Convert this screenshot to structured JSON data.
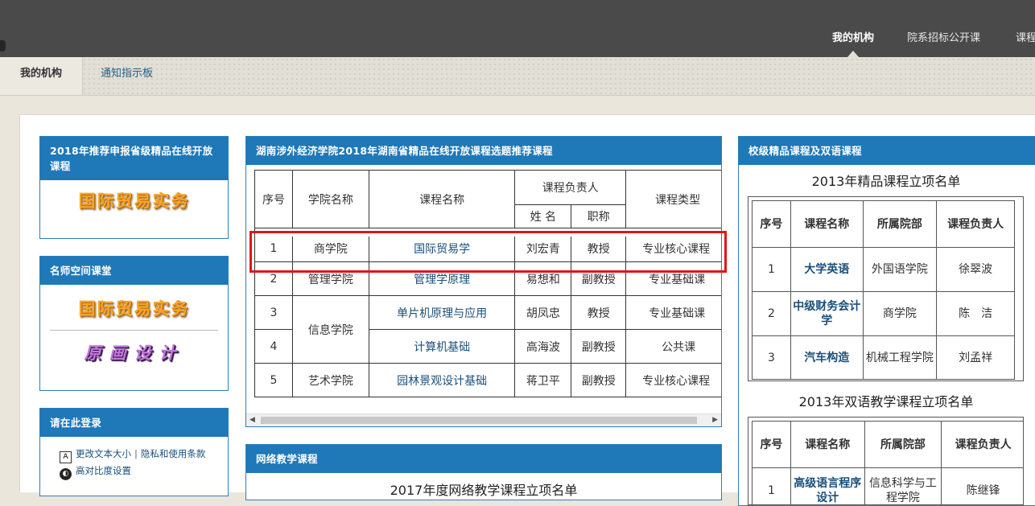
{
  "topnav": {
    "my_org": "我的机构",
    "college_courses": "院系招标公开课",
    "more": "课程"
  },
  "subtabs": {
    "my_org": "我的机构",
    "notice_board": "通知指示板"
  },
  "left": {
    "recommend": {
      "title": "2018年推荐申报省级精品在线开放课程",
      "promo": "国际贸易实务"
    },
    "teacher_space": {
      "title": "名师空间课堂",
      "promo1": "国际贸易实务",
      "promo2": "原画设计"
    },
    "login": {
      "title": "请在此登录",
      "change_text_size": "更改文本大小",
      "privacy": "隐私和使用条款",
      "high_contrast": "高对比度设置",
      "sep": "|"
    }
  },
  "center": {
    "title": "湖南涉外经济学院2018年湖南省精品在线开放课程选题推荐课程",
    "headers": {
      "no": "序号",
      "college": "学院名称",
      "course": "课程名称",
      "leader": "课程负责人",
      "type": "课程类型",
      "name": "姓 名",
      "rank": "职称"
    },
    "rows": [
      {
        "no": "1",
        "college": "商学院",
        "course": "国际贸易学",
        "name": "刘宏青",
        "rank": "教授",
        "type": "专业核心课程"
      },
      {
        "no": "2",
        "college": "管理学院",
        "course": "管理学原理",
        "name": "易想和",
        "rank": "副教授",
        "type": "专业基础课"
      },
      {
        "no": "3",
        "college": "信息学院",
        "course": "单片机原理与应用",
        "name": "胡凤忠",
        "rank": "教授",
        "type": "专业基础课"
      },
      {
        "no": "4",
        "college": "",
        "course": "计算机基础",
        "name": "高海波",
        "rank": "副教授",
        "type": "公共课"
      },
      {
        "no": "5",
        "college": "艺术学院",
        "course": "园林景观设计基础",
        "name": "蒋卫平",
        "rank": "副教授",
        "type": "专业核心课程"
      }
    ],
    "network": {
      "title": "网络教学课程",
      "subtitle": "2017年度网络教学课程立项名单"
    }
  },
  "right": {
    "title": "校级精品课程及双语课程",
    "quality": {
      "title": "2013年精品课程立项名单",
      "headers": {
        "no": "序号",
        "course": "课程名称",
        "dept": "所属院部",
        "leader": "课程负责人"
      },
      "rows": [
        {
          "no": "1",
          "course": "大学英语",
          "dept": "外国语学院",
          "leader": "徐翠波"
        },
        {
          "no": "2",
          "course": "中级财务会计学",
          "dept": "商学院",
          "leader": "陈　洁"
        },
        {
          "no": "3",
          "course": "汽车构造",
          "dept": "机械工程学院",
          "leader": "刘孟祥"
        }
      ]
    },
    "bilingual": {
      "title": "2013年双语教学课程立项名单",
      "headers": {
        "no": "序号",
        "course": "课程名称",
        "dept": "所属院部",
        "leader": "课程负责人"
      },
      "rows": [
        {
          "no": "1",
          "course": "高级语言程序设计",
          "dept": "信息科学与工程学院",
          "leader": "陈继锋"
        }
      ]
    }
  }
}
